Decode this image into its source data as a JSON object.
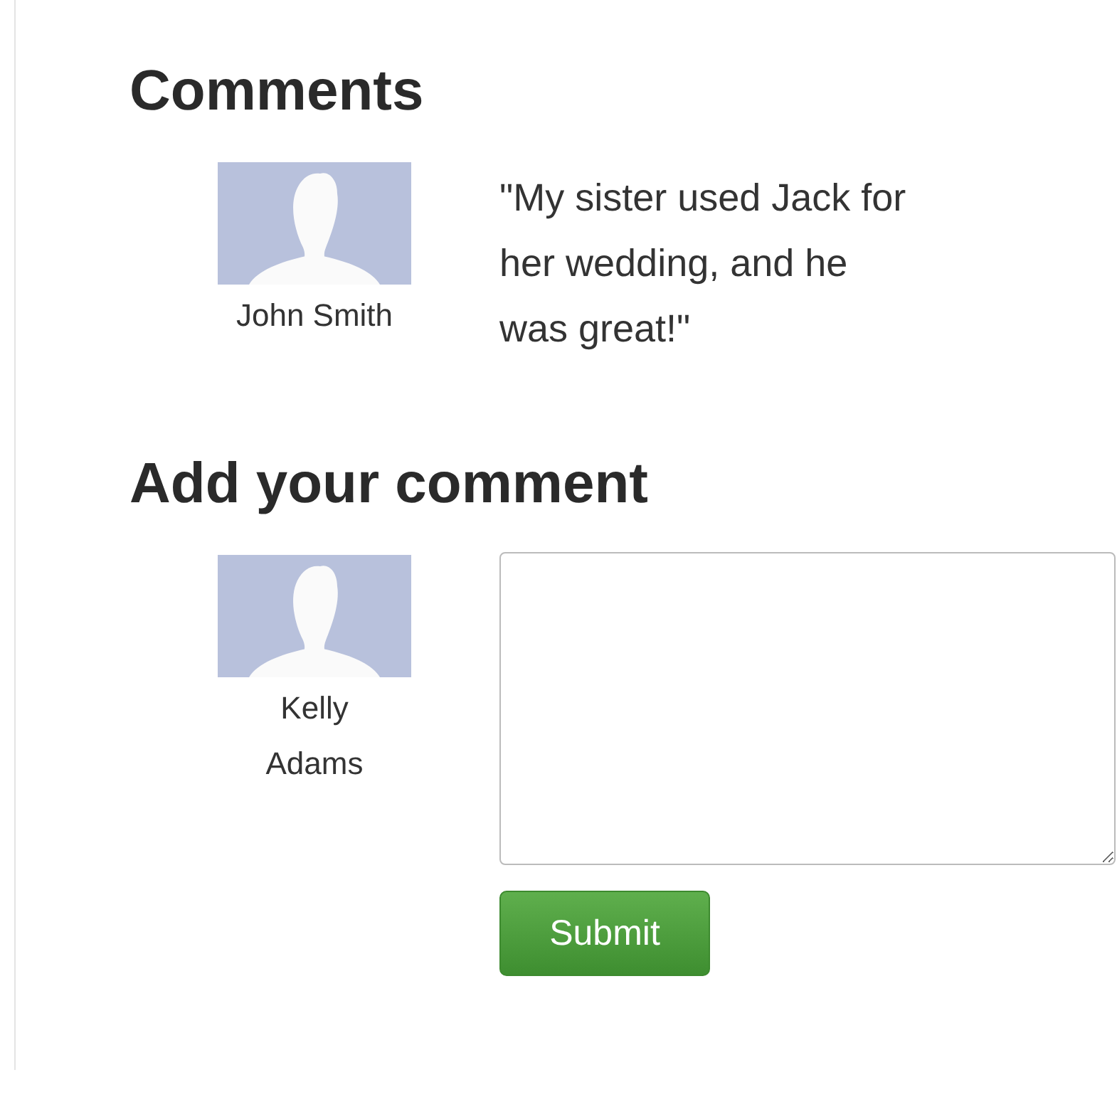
{
  "comments_section": {
    "title": "Comments",
    "comments": [
      {
        "author": "John Smith",
        "text": "\"My sister used Jack for her wedding, and he was great!\""
      }
    ]
  },
  "add_comment": {
    "title": "Add your comment",
    "author": "Kelly Adams",
    "submit": "Submit"
  }
}
